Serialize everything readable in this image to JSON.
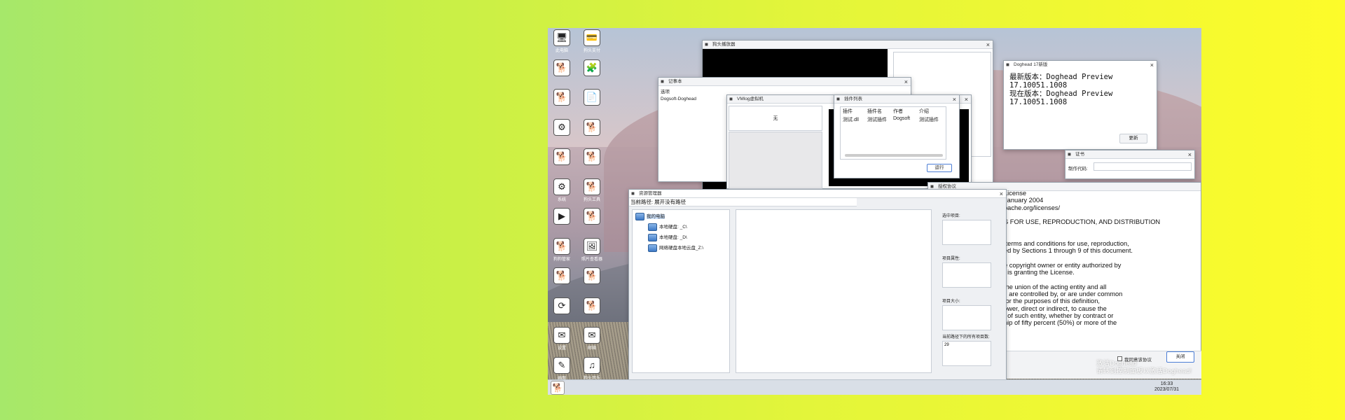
{
  "desktop": {
    "icons": [
      {
        "label": "此电脑",
        "glyph": "🖥",
        "dark": false
      },
      {
        "label": "狗头支付",
        "glyph": "💳",
        "dark": false
      },
      {
        "label": "",
        "glyph": "🐕",
        "dark": false
      },
      {
        "label": "",
        "glyph": "🧩",
        "dark": false
      },
      {
        "label": "",
        "glyph": "🐕",
        "dark": false
      },
      {
        "label": "",
        "glyph": "📄",
        "dark": false
      },
      {
        "label": "",
        "glyph": "⚙",
        "dark": false
      },
      {
        "label": "",
        "glyph": "🐕",
        "dark": false
      },
      {
        "label": "",
        "glyph": "🐕",
        "dark": false
      },
      {
        "label": "",
        "glyph": "🐕",
        "dark": false
      },
      {
        "label": "系统",
        "glyph": "⚙",
        "dark": false
      },
      {
        "label": "狗头工具",
        "glyph": "🐕",
        "dark": false
      },
      {
        "label": "",
        "glyph": "▶",
        "dark": false
      },
      {
        "label": "",
        "glyph": "🐕",
        "dark": false
      },
      {
        "label": "狗狗管家",
        "glyph": "🐕",
        "dark": false
      },
      {
        "label": "照片查看器",
        "glyph": "🖼",
        "dark": false
      },
      {
        "label": "",
        "glyph": "🐕",
        "dark": false
      },
      {
        "label": "",
        "glyph": "🐕",
        "dark": false
      },
      {
        "label": "",
        "glyph": "⟳",
        "dark": false
      },
      {
        "label": "",
        "glyph": "🐕",
        "dark": false
      },
      {
        "label": "设置",
        "glyph": "✉",
        "dark": false
      },
      {
        "label": "邮箱",
        "glyph": "✉",
        "dark": false
      },
      {
        "label": "画图",
        "glyph": "✎",
        "dark": false
      },
      {
        "label": "狗头音乐",
        "glyph": "♫",
        "dark": false
      }
    ]
  },
  "taskbar": {
    "time": "16:33",
    "date": "2023/07/31"
  },
  "windows": {
    "player": {
      "title": "狗头播放器"
    },
    "notepad": {
      "title": "记事本",
      "menu": "选项",
      "content": "Dogsoft-Doghead"
    },
    "vmlog": {
      "title": "VMlog虚拟机",
      "status": "无"
    },
    "plugins": {
      "title": "插件列表",
      "headers": [
        "插件",
        "插件名",
        "作者",
        "介绍"
      ],
      "rows": [
        [
          "测试.dll",
          "测试插件",
          "Dogsoft",
          "测试插件"
        ]
      ],
      "run_label": "运行"
    },
    "updater": {
      "title": "Doghead 17新版",
      "latest_label": "最新版本：Doghead Preview",
      "latest_version": "17.10051.1008",
      "current_label": "现在版本：Doghead Preview",
      "current_version": "17.10051.1008",
      "update_label": "更新"
    },
    "license_key": {
      "title": "证书",
      "field_label": "制作代码:"
    },
    "eula": {
      "title": "授权协议",
      "lines": [
        "License",
        "January 2004",
        "pache.org/licenses/",
        "",
        "S FOR USE, REPRODUCTION, AND DISTRIBUTION",
        "",
        "",
        " terms and conditions for use, reproduction,",
        "ed by Sections 1 through 9 of this document.",
        "",
        "e copyright owner or entity authorized by",
        "t is granting the License.",
        "",
        "the union of the acting entity and all",
        "l, are controlled by, or are under common",
        "for the purposes of this definition,",
        "ower, direct or indirect, to cause the",
        "t of such entity, whether by contract or",
        "hip of fifty percent (50%) or more of the"
      ],
      "agree_label": "我同意该协议",
      "close_label": "关闭"
    },
    "file_manager": {
      "title": "资源管理器",
      "path_label": "当前路径: 展开没有路径",
      "tree": [
        {
          "label": "我的电脑",
          "level": 0
        },
        {
          "label": "本地硬盘: _C\\",
          "level": 1
        },
        {
          "label": "本地硬盘: _D\\",
          "level": 1
        },
        {
          "label": "网络硬盘本地云盘_Z:\\",
          "level": 1
        }
      ],
      "side": {
        "selected_label": "选中项目:",
        "props_label": "项目属性:",
        "size_label": "项目大小:",
        "count_label": "当前路径下的所有项目数:",
        "count_value": "29"
      }
    }
  },
  "activation": {
    "line1": "激活Doghead",
    "line2": "请转到控制面板以激活Doghead!"
  }
}
